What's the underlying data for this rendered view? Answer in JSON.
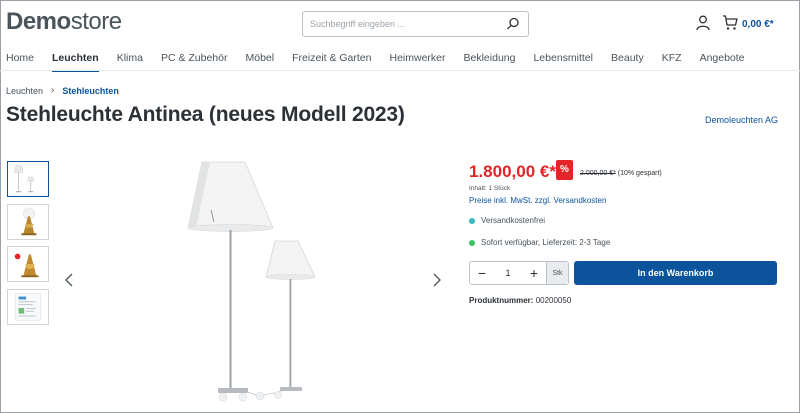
{
  "header": {
    "logo_bold": "Demo",
    "logo_light": "store",
    "search_placeholder": "Suchbegriff eingeben ...",
    "cart_total": "0,00 €*"
  },
  "nav": [
    {
      "label": "Home",
      "active": false
    },
    {
      "label": "Leuchten",
      "active": true
    },
    {
      "label": "Klima",
      "active": false
    },
    {
      "label": "PC & Zubehör",
      "active": false
    },
    {
      "label": "Möbel",
      "active": false
    },
    {
      "label": "Freizeit & Garten",
      "active": false
    },
    {
      "label": "Heimwerker",
      "active": false
    },
    {
      "label": "Bekleidung",
      "active": false
    },
    {
      "label": "Lebensmittel",
      "active": false
    },
    {
      "label": "Beauty",
      "active": false
    },
    {
      "label": "KFZ",
      "active": false
    },
    {
      "label": "Angebote",
      "active": false
    }
  ],
  "breadcrumb": {
    "parent": "Leuchten",
    "current": "Stehleuchten"
  },
  "product": {
    "title": "Stehleuchte Antinea (neues Modell 2023)",
    "manufacturer": "Demoleuchten AG",
    "price": "1.800,00 €*",
    "discount_badge": "%",
    "old_price": "2.000,00 €*",
    "saving": "(10% gespart)",
    "content": "Inhalt: 1 Stück",
    "tax_link": "Preise inkl. MwSt. zzgl. Versandkosten",
    "shipping_free": "Versandkostenfrei",
    "availability": "Sofort verfügbar, Lieferzeit: 2-3 Tage",
    "quantity": "1",
    "unit": "Stk",
    "buy_label": "In den Warenkorb",
    "article_label": "Produktnummer:",
    "article_number": "00200050"
  },
  "colors": {
    "accent": "#0b539b",
    "price_red": "#e52427",
    "status_teal": "#37b9c4",
    "status_green": "#3cc261"
  }
}
